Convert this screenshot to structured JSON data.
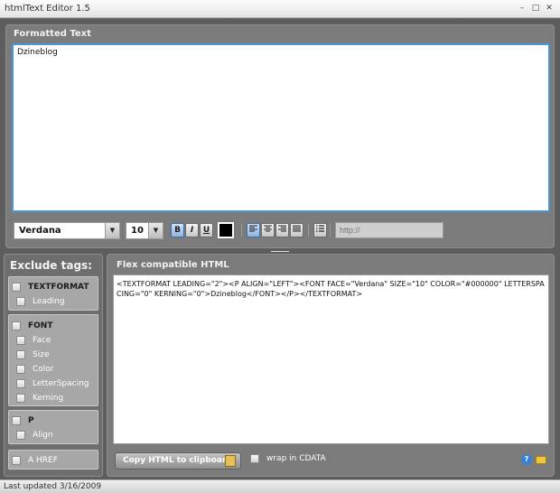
{
  "window": {
    "title": "htmlText Editor 1.5",
    "minimize": "–",
    "restore": "□",
    "close": "✕"
  },
  "formatted": {
    "label": "Formatted Text",
    "content": "Dzineblog",
    "font_value": "Verdana",
    "size_value": "10",
    "bold": "B",
    "italic": "I",
    "underline": "U",
    "color": "#000000",
    "url_placeholder": "http://"
  },
  "exclude": {
    "title": "Exclude tags:",
    "groups": [
      {
        "name": "TEXTFORMAT",
        "items": [
          "Leading"
        ]
      },
      {
        "name": "FONT",
        "items": [
          "Face",
          "Size",
          "Color",
          "LetterSpacing",
          "Kerning"
        ]
      },
      {
        "name": "P",
        "items": [
          "Align"
        ]
      },
      {
        "name": "A HREF",
        "items": []
      }
    ]
  },
  "html_panel": {
    "label": "Flex compatible HTML",
    "code": "<TEXTFORMAT LEADING=\"2\"><P ALIGN=\"LEFT\"><FONT FACE=\"Verdana\" SIZE=\"10\" COLOR=\"#000000\" LETTERSPACING=\"0\" KERNING=\"0\">Dzineblog</FONT></P></TEXTFORMAT>",
    "copy_label": "Copy HTML to clipboard",
    "cdata_label": "wrap in CDATA",
    "help": "?"
  },
  "status": "Last updated 3/16/2009"
}
